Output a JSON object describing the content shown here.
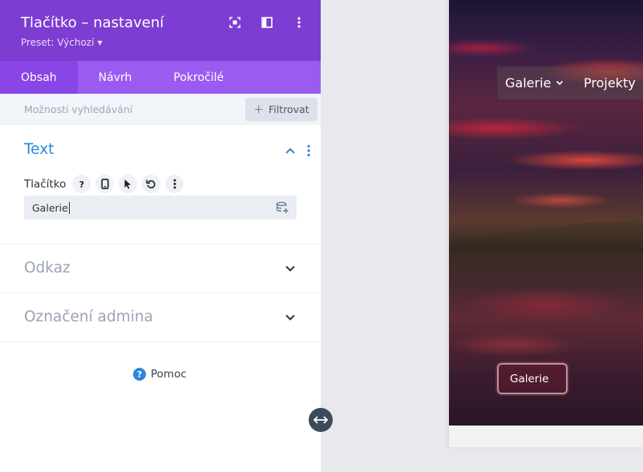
{
  "panel": {
    "title": "Tlačítko – nastavení",
    "preset_label": "Preset: Výchozí",
    "header_icons": [
      "fullscreen-icon",
      "layout-toggle-icon",
      "more-vertical-icon"
    ],
    "tabs": [
      {
        "label": "Obsah",
        "active": true
      },
      {
        "label": "Návrh",
        "active": false
      },
      {
        "label": "Pokročilé",
        "active": false
      }
    ],
    "search": {
      "placeholder": "Možnosti vyhledávání"
    },
    "filter_label": "Filtrovat"
  },
  "sections": {
    "text": {
      "title": "Text",
      "expanded": true,
      "field_label": "Tlačítko",
      "field_value": "Galerie",
      "field_tools": [
        "help-icon",
        "mobile-icon",
        "cursor-hover-icon",
        "reset-icon",
        "more-vertical-icon"
      ]
    },
    "link": {
      "title": "Odkaz",
      "expanded": false
    },
    "admin": {
      "title": "Označení admina",
      "expanded": false
    }
  },
  "help": {
    "label": "Pomoc",
    "icon_glyph": "?"
  },
  "canvas": {
    "nav_items": [
      "Galerie",
      "Projekty"
    ],
    "hero_button_label": "Galerie"
  },
  "colors": {
    "header": "#7d3cd2",
    "tabs": "#9b5bf0",
    "accent_blue": "#2b87da",
    "handle": "#3d4a5b"
  }
}
